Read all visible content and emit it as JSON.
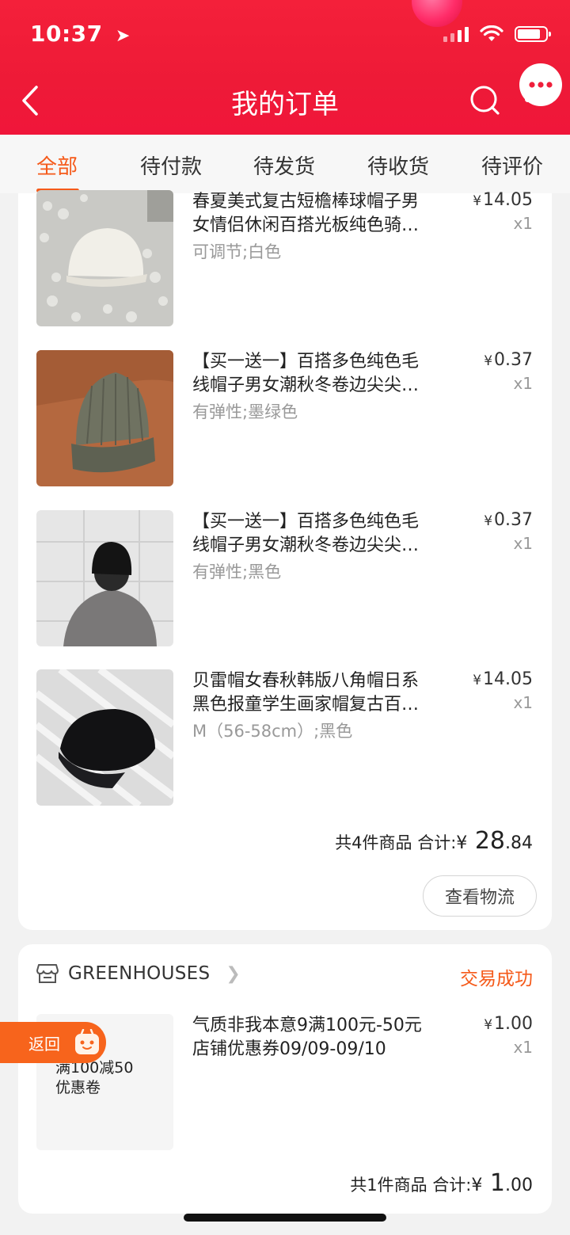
{
  "status_bar": {
    "time": "10:37",
    "location_icon": "location-arrow-icon",
    "signal_icon": "cell-signal-icon",
    "wifi_icon": "wifi-icon",
    "battery_icon": "battery-icon"
  },
  "header": {
    "title": "我的订单",
    "back_icon": "chevron-left-icon",
    "search_icon": "search-icon",
    "message_icon": "message-bubble-icon"
  },
  "tabs": [
    {
      "label": "全部",
      "active": true
    },
    {
      "label": "待付款",
      "active": false
    },
    {
      "label": "待发货",
      "active": false
    },
    {
      "label": "待收货",
      "active": false
    },
    {
      "label": "待评价",
      "active": false
    }
  ],
  "order1": {
    "items": [
      {
        "title_line1": "春夏美式复古短檐棒球帽子男",
        "title_line2": "女情侣休闲百搭光板纯色骑…",
        "spec": "可调节;白色",
        "currency": "¥",
        "price": "14.05",
        "qty": "x1"
      },
      {
        "title_line1": "【买一送一】百搭多色纯色毛",
        "title_line2": "线帽子男女潮秋冬卷边尖尖…",
        "spec": "有弹性;墨绿色",
        "currency": "¥",
        "price": "0.37",
        "qty": "x1"
      },
      {
        "title_line1": "【买一送一】百搭多色纯色毛",
        "title_line2": "线帽子男女潮秋冬卷边尖尖…",
        "spec": "有弹性;黑色",
        "currency": "¥",
        "price": "0.37",
        "qty": "x1"
      },
      {
        "title_line1": "贝雷帽女春秋韩版八角帽日系",
        "title_line2": "黑色报童学生画家帽复古百…",
        "spec": "M（56-58cm）;黑色",
        "currency": "¥",
        "price": "14.05",
        "qty": "x1"
      }
    ],
    "total_label": "共4件商品 合计:",
    "total_currency": "¥",
    "total_int": " 28",
    "total_dec": ".84",
    "logistics_button": "查看物流"
  },
  "order2": {
    "shop_name": "GREENHOUSES",
    "shop_icon": "store-icon",
    "status": "交易成功",
    "item": {
      "thumb_text_line1": "满100减50",
      "thumb_text_line2": "优惠卷",
      "title_line1": "气质非我本意9满100元-50元",
      "title_line2": "店铺优惠券09/09-09/10",
      "currency": "¥",
      "price": "1.00",
      "qty": "x1"
    },
    "total_label": "共1件商品 合计:",
    "total_currency": "¥",
    "total_int": " 1",
    "total_dec": ".00"
  },
  "floating": {
    "return_label": "返回",
    "return_icon": "shopping-bag-face-icon"
  }
}
